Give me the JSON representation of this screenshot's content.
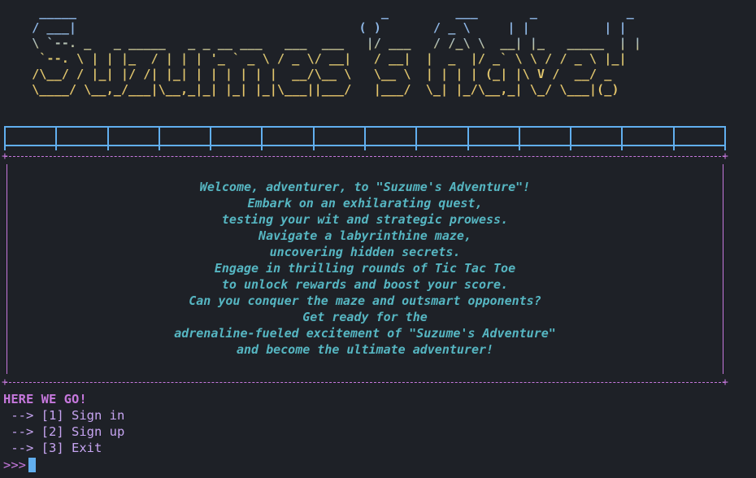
{
  "banner": {
    "ascii": "  _____                                         _         ___       _            _\n / ___|                                      ( )       / _ \\     | |          | |\n \\ `--. _   _ _____   _ _ __ ___   ___  ___   |/ ___   / /_\\ \\  __| |_   _____  | |\n  `--. \\ | | |_  / | | | '_ ` _ \\ / _ \\/ __|   / __|  |  _  |/ _` \\ \\ / / _ \\ |_|\n /\\__/ / |_| |/ /| |_| | | | | | |  __/\\__ \\   \\__ \\  | | | | (_| |\\ V /  __/ _ \n \\____/ \\__,_/___|\\__,_|_| |_| |_|\\___||___/   |___/  \\_| |_/\\__,_| \\_/ \\___|(_)"
  },
  "welcome": {
    "lines": [
      "Welcome, adventurer, to \"Suzume's Adventure\"!",
      "Embark on an exhilarating quest,",
      "testing your wit and strategic prowess.",
      "Navigate a labyrinthine maze,",
      "uncovering hidden secrets.",
      "Engage in thrilling rounds of Tic Tac Toe",
      "to unlock rewards and boost your score.",
      "Can you conquer the maze and outsmart opponents?",
      "Get ready for the",
      "adrenaline-fueled excitement of \"Suzume's Adventure\"",
      "and become the ultimate adventurer!"
    ]
  },
  "menu": {
    "heading": "HERE WE GO!",
    "options": [
      " --> [1] Sign in",
      " --> [2] Sign up",
      " --> [3] Exit"
    ]
  },
  "prompt": {
    "symbol": ">>>",
    "value": ""
  },
  "colors": {
    "background": "#1e2127",
    "accent_blue": "#61afef",
    "accent_purple": "#c678dd",
    "text_cyan": "#56b6c2",
    "banner_gold": "#e5c07b"
  }
}
